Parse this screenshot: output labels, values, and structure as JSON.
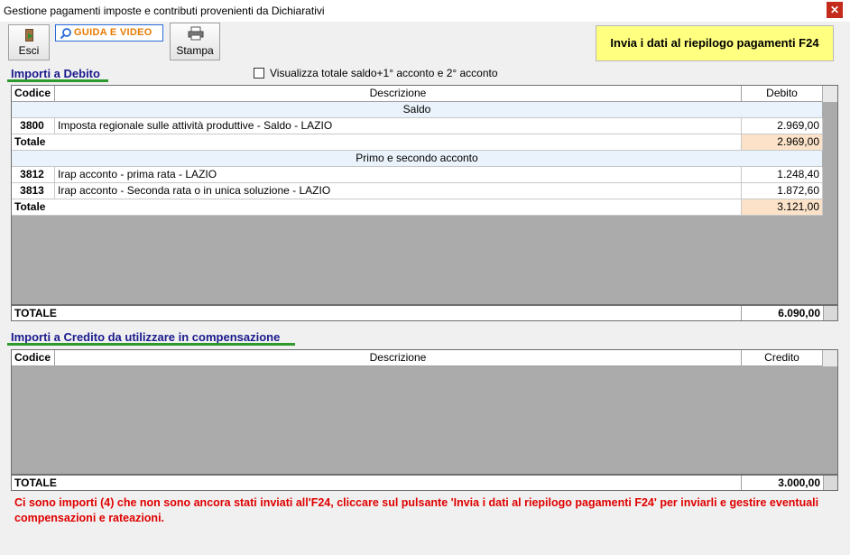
{
  "window": {
    "title": "Gestione pagamenti imposte e contributi provenienti da Dichiarativi",
    "close_glyph": "✕"
  },
  "toolbar": {
    "esci_label": "Esci",
    "esci_icon": "exit-door-icon",
    "guida_label": "GUIDA E VIDEO",
    "guida_icon": "magnifier-icon",
    "stampa_label": "Stampa",
    "stampa_icon": "printer-icon",
    "invia_label": "Invia i dati al riepilogo pagamenti F24"
  },
  "debito": {
    "section_title": "Importi a Debito",
    "checkbox_label": "Visualizza totale saldo+1° acconto e 2° acconto",
    "checkbox_checked": false,
    "columns": [
      "Codice",
      "Descrizione",
      "Debito"
    ],
    "groups": [
      {
        "title": "Saldo",
        "rows": [
          {
            "codice": "3800",
            "descrizione": "Imposta regionale sulle attività produttive - Saldo - LAZIO",
            "importo": "2.969,00"
          }
        ],
        "totale_label": "Totale",
        "totale": "2.969,00"
      },
      {
        "title": "Primo e secondo acconto",
        "rows": [
          {
            "codice": "3812",
            "descrizione": "Irap acconto - prima rata - LAZIO",
            "importo": "1.248,40"
          },
          {
            "codice": "3813",
            "descrizione": "Irap acconto - Seconda rata o in unica soluzione - LAZIO",
            "importo": "1.872,60"
          }
        ],
        "totale_label": "Totale",
        "totale": "3.121,00"
      }
    ],
    "grand_total_label": "TOTALE",
    "grand_total": "6.090,00"
  },
  "credito": {
    "section_title": "Importi a Credito da utilizzare in compensazione",
    "columns": [
      "Codice",
      "Descrizione",
      "Credito"
    ],
    "grand_total_label": "TOTALE",
    "grand_total": "3.000,00"
  },
  "message": "Ci sono importi (4) che non sono ancora stati inviati all'F24, cliccare sul pulsante 'Invia i dati al riepilogo pagamenti F24' per inviarli e gestire eventuali compensazioni e rateazioni.",
  "colors": {
    "invia_bg": "#ffff80",
    "section_title": "#1a1a8c",
    "underline": "#2e9a2e",
    "total_cell": "#fbe2c8",
    "band_bg": "#eaf3fb",
    "message": "#e00000"
  }
}
